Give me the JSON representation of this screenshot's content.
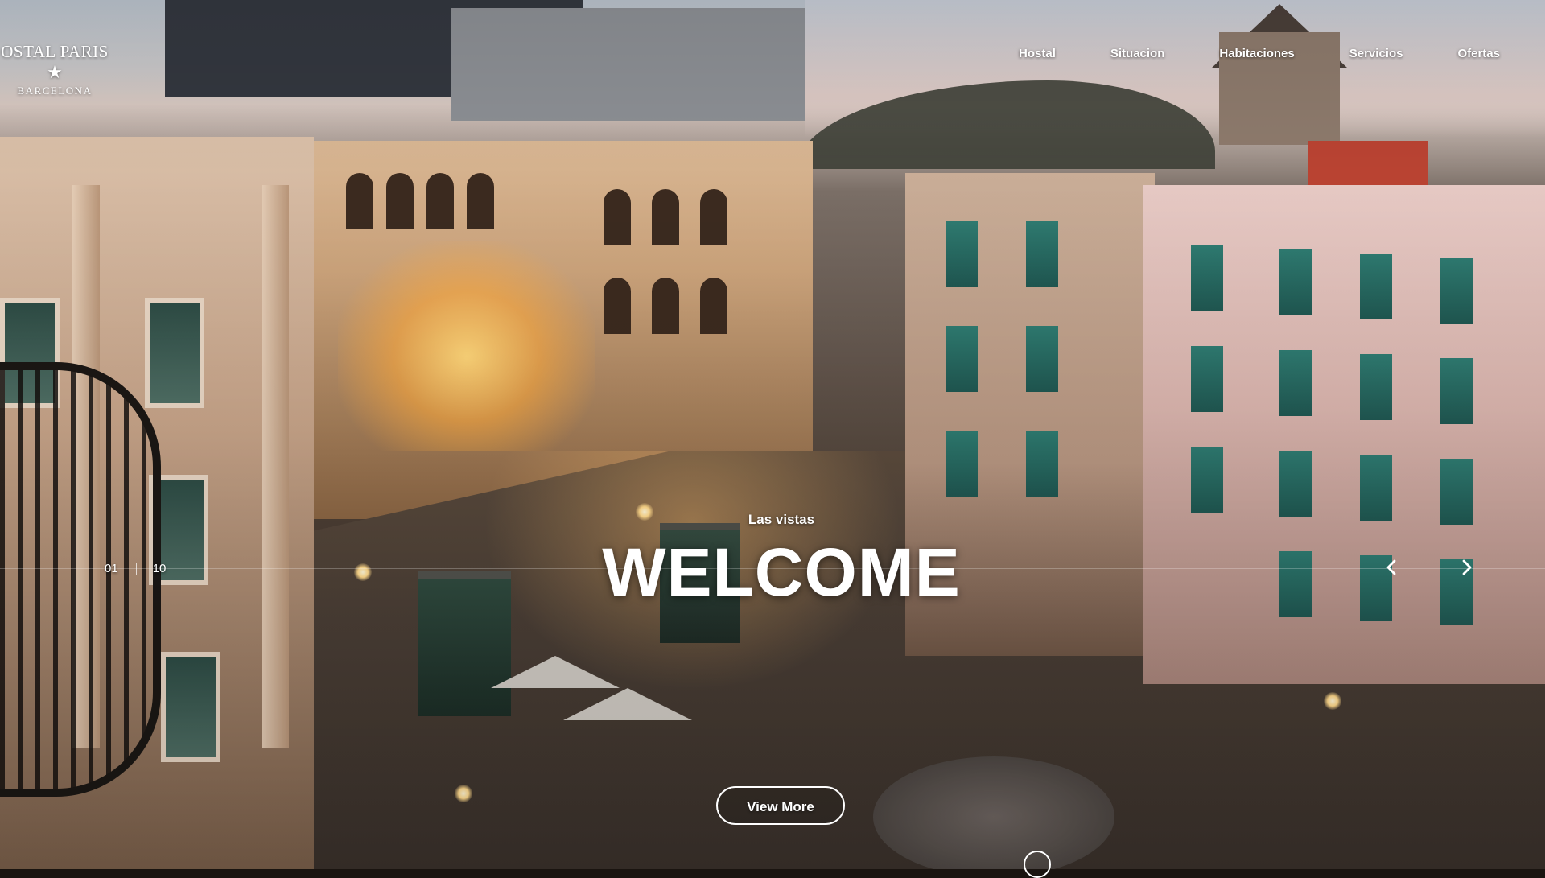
{
  "logo": {
    "name": "OSTAL PARIS",
    "star": "★",
    "city": "BARCELONA"
  },
  "nav": {
    "items": [
      {
        "label": "Hostal"
      },
      {
        "label": "Situacion"
      },
      {
        "label": "Habitaciones"
      },
      {
        "label": "Servicios"
      },
      {
        "label": "Ofertas"
      }
    ]
  },
  "slide": {
    "kicker": "Las vistas",
    "headline": "WELCOME",
    "cta_label": "View More",
    "current": "01",
    "total": "10"
  },
  "icons": {
    "prev": "chevron-left-icon",
    "next": "chevron-right-icon",
    "scroll": "scroll-down-icon"
  },
  "colors": {
    "text": "#ffffff",
    "overlay": "#000000"
  }
}
